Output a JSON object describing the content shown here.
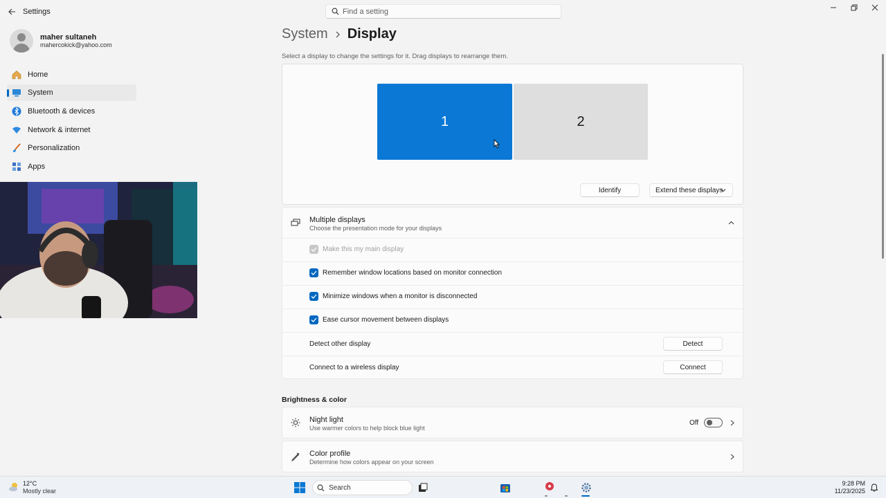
{
  "titlebar": {
    "app_title": "Settings",
    "search_placeholder": "Find a setting"
  },
  "user": {
    "name": "maher sultaneh",
    "email": "mahercokick@yahoo.com"
  },
  "sidebar": {
    "items": [
      {
        "label": "Home",
        "icon": "home-icon"
      },
      {
        "label": "System",
        "icon": "monitor-icon",
        "active": true
      },
      {
        "label": "Bluetooth & devices",
        "icon": "bluetooth-icon"
      },
      {
        "label": "Network & internet",
        "icon": "wifi-icon"
      },
      {
        "label": "Personalization",
        "icon": "brush-icon"
      },
      {
        "label": "Apps",
        "icon": "apps-icon"
      }
    ]
  },
  "breadcrumb": {
    "parent": "System",
    "current": "Display"
  },
  "arrange": {
    "hint": "Select a display to change the settings for it. Drag displays to rearrange them.",
    "monitor_1": "1",
    "monitor_2": "2",
    "selected_monitor": "1",
    "identify_label": "Identify",
    "mode_label": "Extend these displays"
  },
  "multiple_displays": {
    "title": "Multiple displays",
    "subtitle": "Choose the presentation mode for your displays",
    "expanded": true,
    "options": [
      {
        "label": "Make this my main display",
        "checked": true,
        "disabled": true
      },
      {
        "label": "Remember window locations based on monitor connection",
        "checked": true,
        "disabled": false
      },
      {
        "label": "Minimize windows when a monitor is disconnected",
        "checked": true,
        "disabled": false
      },
      {
        "label": "Ease cursor movement between displays",
        "checked": true,
        "disabled": false
      }
    ],
    "detect_label": "Detect other display",
    "detect_button": "Detect",
    "wireless_label": "Connect to a wireless display",
    "connect_button": "Connect"
  },
  "brightness": {
    "section_title": "Brightness & color",
    "night_light": {
      "title": "Night light",
      "subtitle": "Use warmer colors to help block blue light",
      "state_label": "Off",
      "on": false
    },
    "color_profile": {
      "title": "Color profile",
      "subtitle": "Determine how colors appear on your screen"
    }
  },
  "taskbar": {
    "temperature": "12°C",
    "condition": "Mostly clear",
    "search_label": "Search",
    "time": "9:28 PM",
    "date": "11/23/2025"
  },
  "colors": {
    "accent": "#0067c0",
    "selected_monitor": "#0a78d4",
    "background": "#f3f3f3"
  }
}
